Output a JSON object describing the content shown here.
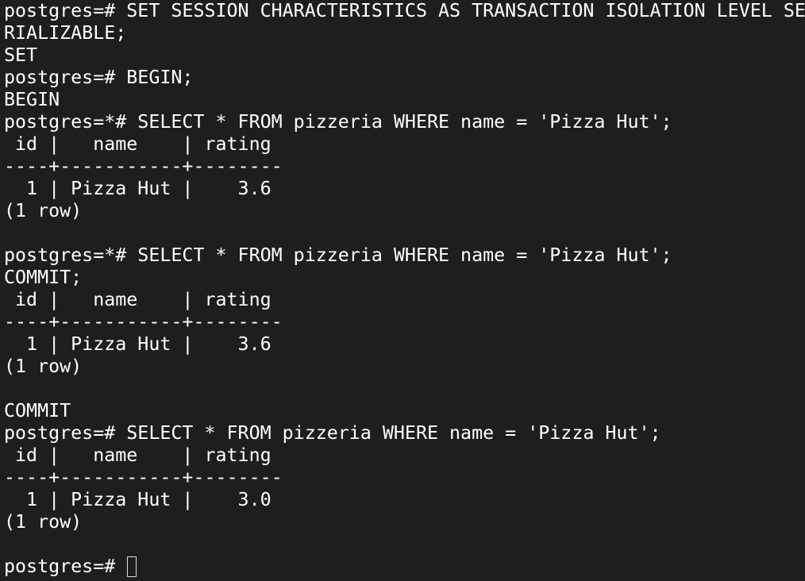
{
  "terminal": {
    "lines": [
      "postgres=# SET SESSION CHARACTERISTICS AS TRANSACTION ISOLATION LEVEL SE",
      "RIALIZABLE;",
      "SET",
      "postgres=# BEGIN;",
      "BEGIN",
      "postgres=*# SELECT * FROM pizzeria WHERE name = 'Pizza Hut';",
      " id |   name    | rating",
      "----+-----------+--------",
      "  1 | Pizza Hut |    3.6",
      "(1 row)",
      "",
      "postgres=*# SELECT * FROM pizzeria WHERE name = 'Pizza Hut';",
      "COMMIT;",
      " id |   name    | rating",
      "----+-----------+--------",
      "  1 | Pizza Hut |    3.6",
      "(1 row)",
      "",
      "COMMIT",
      "postgres=# SELECT * FROM pizzeria WHERE name = 'Pizza Hut';",
      " id |   name    | rating",
      "----+-----------+--------",
      "  1 | Pizza Hut |    3.0",
      "(1 row)",
      "",
      "postgres=# "
    ]
  }
}
